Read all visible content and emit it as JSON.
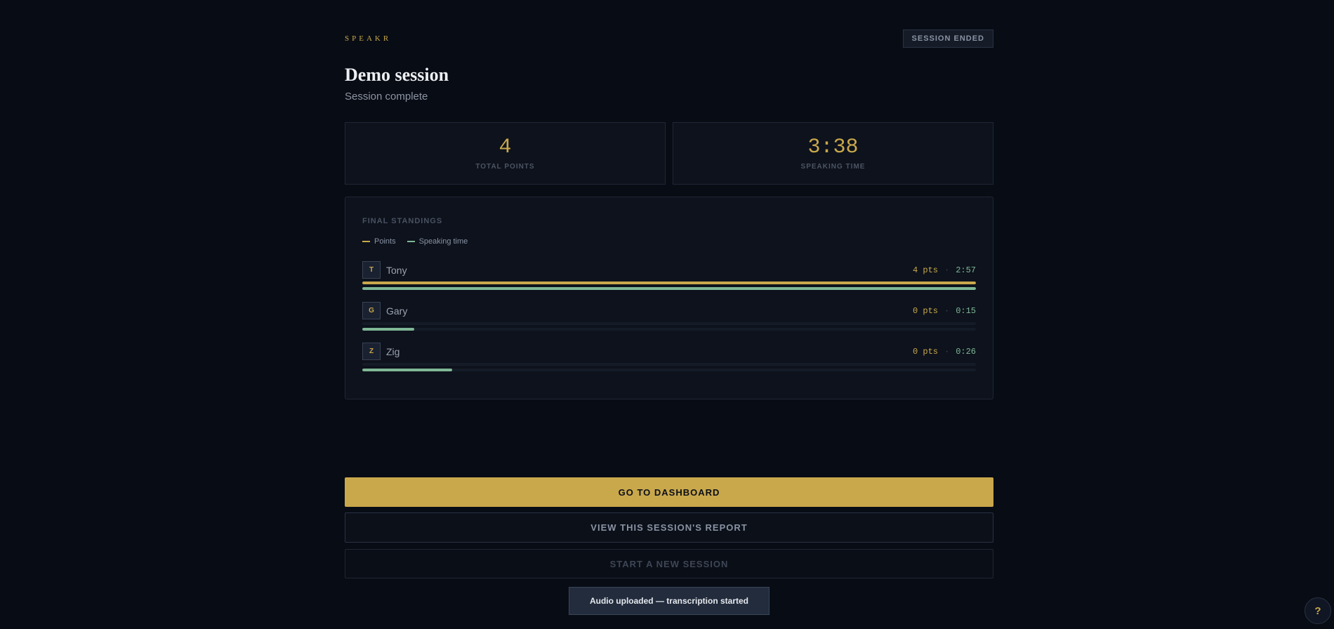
{
  "header": {
    "brand": "SPEAKR",
    "status": "SESSION ENDED"
  },
  "session": {
    "title": "Demo session",
    "subtitle": "Session complete"
  },
  "stats": [
    {
      "value": "4",
      "label": "TOTAL POINTS"
    },
    {
      "value": "3:38",
      "label": "SPEAKING TIME"
    }
  ],
  "standings": {
    "title": "FINAL STANDINGS",
    "legend": [
      {
        "label": "Points",
        "color": "#c9a84c"
      },
      {
        "label": "Speaking time",
        "color": "#7fb796"
      }
    ],
    "rows": [
      {
        "initial": "T",
        "name": "Tony",
        "points": "4 pts",
        "separator": "·",
        "time": "2:57",
        "points_fraction": 1.0,
        "time_fraction": 1.0
      },
      {
        "initial": "G",
        "name": "Gary",
        "points": "0 pts",
        "separator": "·",
        "time": "0:15",
        "points_fraction": 0.0,
        "time_fraction": 0.085
      },
      {
        "initial": "Z",
        "name": "Zig",
        "points": "0 pts",
        "separator": "·",
        "time": "0:26",
        "points_fraction": 0.0,
        "time_fraction": 0.147
      }
    ]
  },
  "actions": {
    "dashboard": "GO TO DASHBOARD",
    "report": "VIEW THIS SESSION'S REPORT",
    "new_session": "START A NEW SESSION"
  },
  "toast": "Audio uploaded — transcription started",
  "help": "?",
  "colors": {
    "accent": "#c9a84c",
    "speaking": "#7fb796",
    "background": "#080c14"
  }
}
